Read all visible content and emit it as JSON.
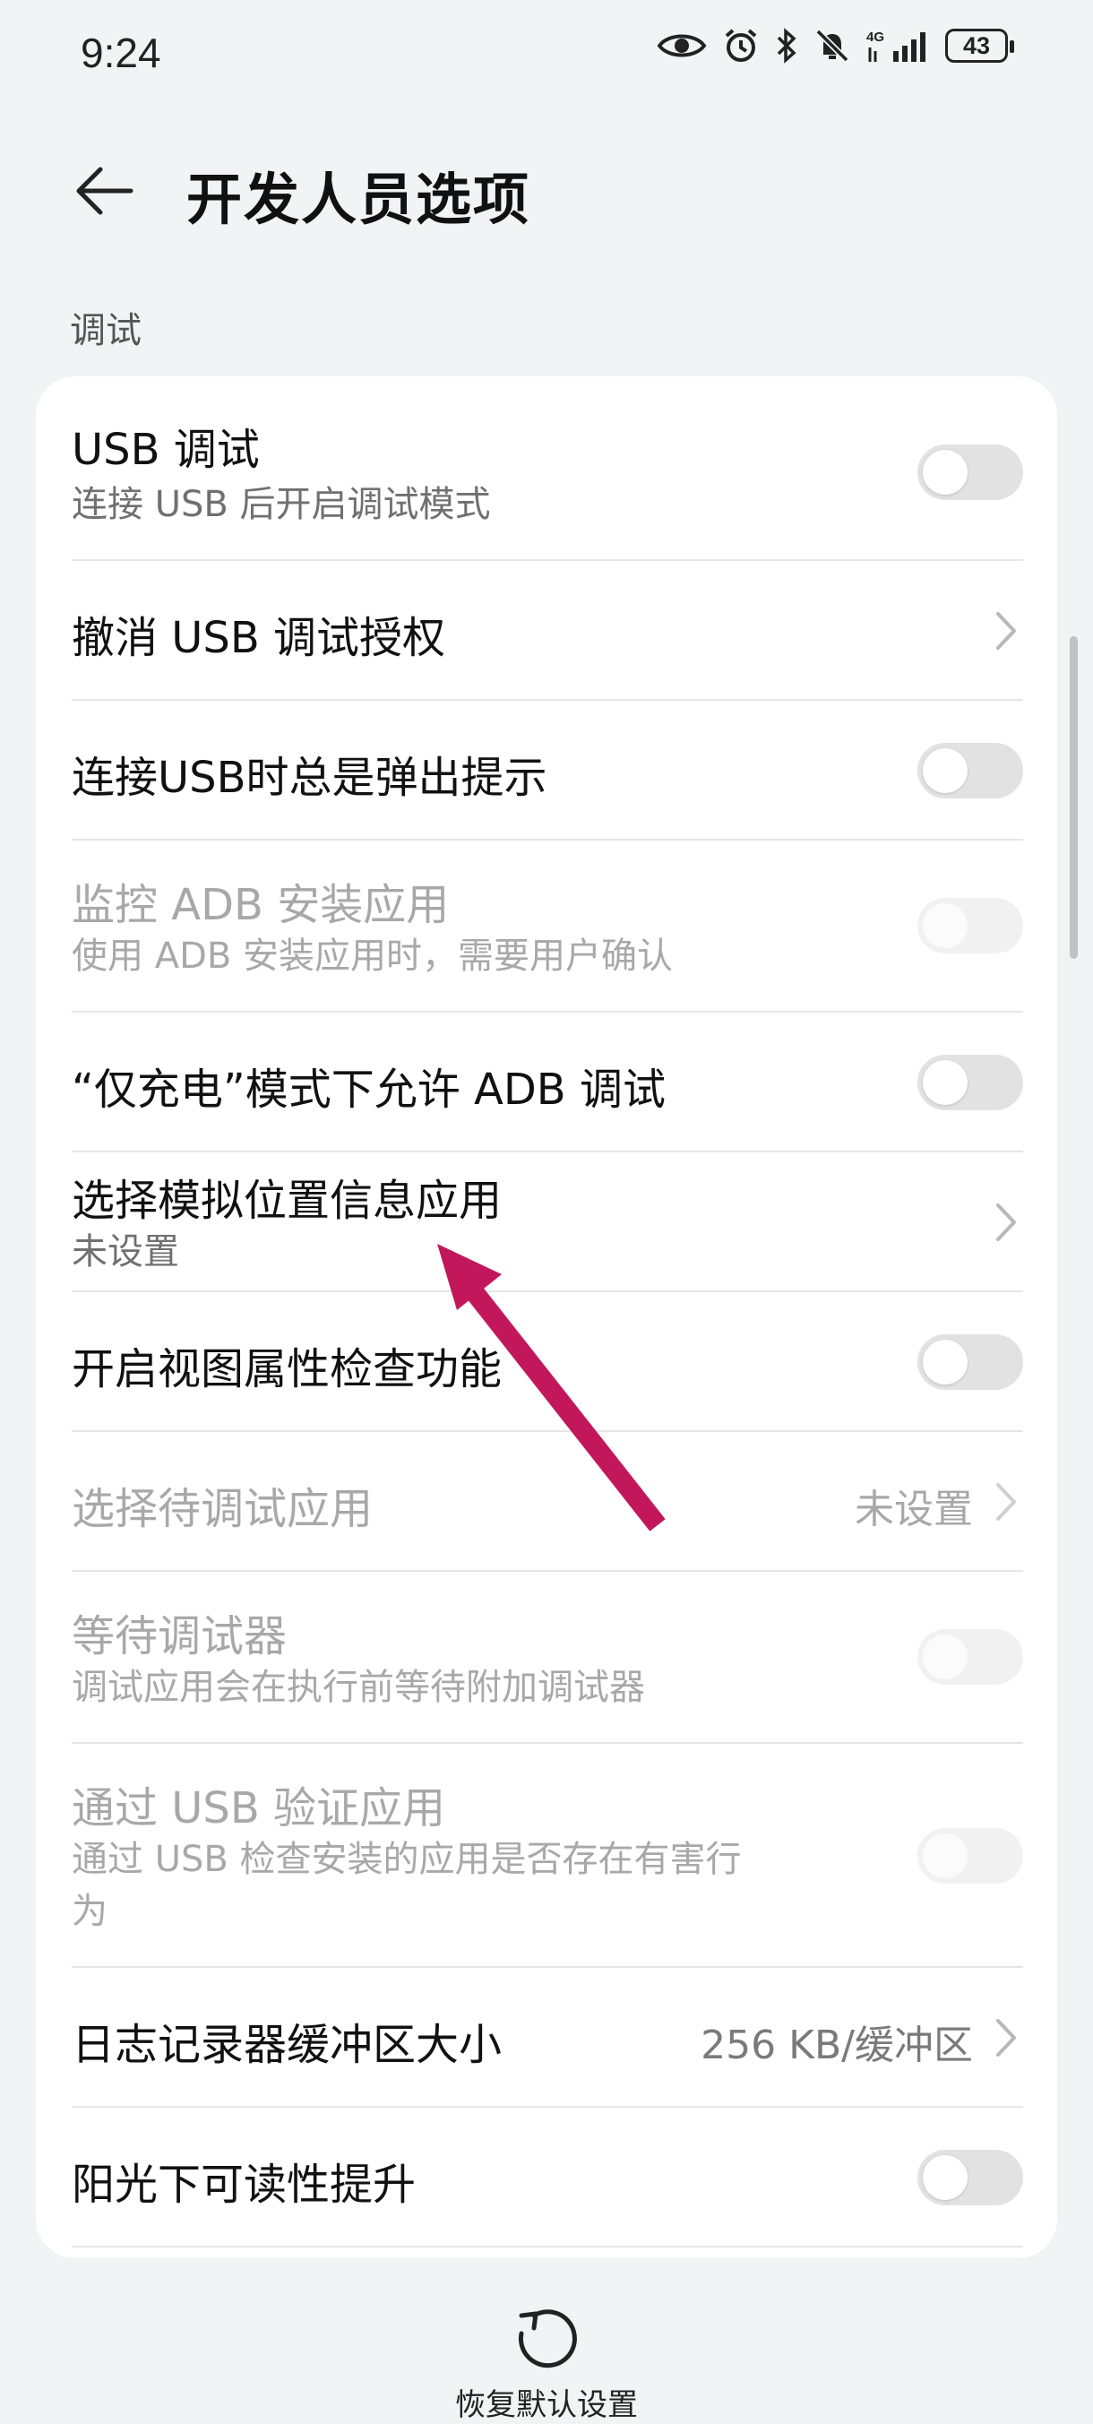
{
  "status_bar": {
    "time": "9:24",
    "network": "4G",
    "battery": "43",
    "icons": [
      "eye-icon",
      "alarm-icon",
      "bluetooth-icon",
      "mute-icon",
      "signal-icon",
      "battery-icon"
    ]
  },
  "header": {
    "title": "开发人员选项",
    "back_icon": "back-arrow-icon"
  },
  "section": {
    "label": "调试"
  },
  "rows": [
    {
      "title": "USB 调试",
      "subtitle": "连接 USB 后开启调试模式",
      "control": "toggle",
      "on": false,
      "enabled": true
    },
    {
      "title": "撤消 USB 调试授权",
      "control": "chevron",
      "enabled": true
    },
    {
      "title": "连接USB时总是弹出提示",
      "control": "toggle",
      "on": false,
      "enabled": true
    },
    {
      "title": "监控 ADB 安装应用",
      "subtitle": "使用 ADB 安装应用时，需要用户确认",
      "control": "toggle",
      "on": false,
      "enabled": false
    },
    {
      "title": "“仅充电”模式下允许 ADB 调试",
      "control": "toggle",
      "on": false,
      "enabled": true
    },
    {
      "title": "选择模拟位置信息应用",
      "subtitle": "未设置",
      "control": "chevron",
      "enabled": true
    },
    {
      "title": "开启视图属性检查功能",
      "control": "toggle",
      "on": false,
      "enabled": true
    },
    {
      "title": "选择待调试应用",
      "value": "未设置",
      "control": "chevron",
      "enabled": false
    },
    {
      "title": "等待调试器",
      "subtitle": "调试应用会在执行前等待附加调试器",
      "control": "toggle",
      "on": false,
      "enabled": false
    },
    {
      "title": "通过 USB 验证应用",
      "subtitle_line1": "通过 USB 检查安装的应用是否存在有害行",
      "subtitle_line2": "为",
      "control": "toggle",
      "on": false,
      "enabled": false
    },
    {
      "title": "日志记录器缓冲区大小",
      "value": "256 KB/缓冲区",
      "control": "chevron",
      "enabled": true
    },
    {
      "title": "阳光下可读性提升",
      "control": "toggle",
      "on": false,
      "enabled": true
    }
  ],
  "bottom": {
    "restore_label": "恢复默认设置",
    "restore_icon": "restore-icon"
  },
  "colors": {
    "background": "#f1f3f5",
    "card": "#ffffff",
    "annotation_arrow": "#c2185b"
  }
}
